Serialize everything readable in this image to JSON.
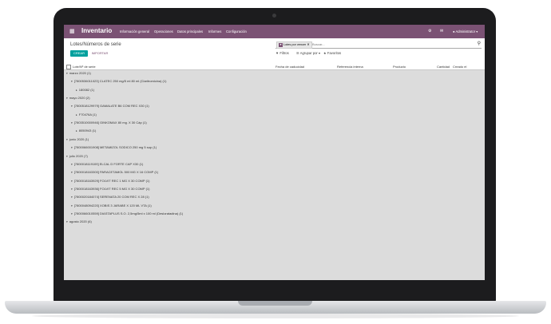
{
  "app": {
    "name": "Inventario"
  },
  "menu": [
    "Información general",
    "Operaciones",
    "Datos principales",
    "Informes",
    "Configuración"
  ],
  "user": {
    "name": "Administrator"
  },
  "control_panel": {
    "breadcrumb": "Lotes/Números de serie",
    "create": "CREAR",
    "import": "IMPORTAR",
    "facet": "Lotes por vencer",
    "search_placeholder": "Buscar...",
    "filters": "Filtros",
    "group_by": "Agrupar por",
    "favorites": "Favoritos"
  },
  "table": {
    "columns": [
      "Lote/Nº de serie",
      "Fecha de caducidad",
      "Referencia interna",
      "Producto",
      "Cantidad",
      "Creado el"
    ]
  },
  "groups": [
    {
      "label": "marzo 2020 (1)",
      "level": 0
    },
    {
      "label": "[7800536011023] CLATEC 250 mg/5 ml 80 ml (Claritromicina) (1)",
      "level": 1
    },
    {
      "label": "180082 (1)",
      "level": 2
    },
    {
      "label": "mayo 2020 (2)",
      "level": 0
    },
    {
      "label": "[7800518129979] GAMALATE B6 COM REC X30 (1)",
      "level": 1
    },
    {
      "label": "F70476A (1)",
      "level": 2
    },
    {
      "label": "[7803510000946] GINKOMAX 80 mg. X 30 Cáp (1)",
      "level": 1
    },
    {
      "label": "8050943 (1)",
      "level": 2
    },
    {
      "label": "junio 2020 (1)",
      "level": 0
    },
    {
      "label": "[7800066001908] METAMIZOL SODICO 250 mg 5 sup (1)",
      "level": 1
    },
    {
      "label": "julio 2020 (7)",
      "level": 0
    },
    {
      "label": "[7800018119109] ELCAL D FORTE CAP X30 (1)",
      "level": 1
    },
    {
      "label": "[7800018163300] PARACETAMOL 500 MG X 16 COMP (1)",
      "level": 1
    },
    {
      "label": "[7800018163929] FOLVIT REC 1 MG X 30 COMP (1)",
      "level": 1
    },
    {
      "label": "[7800018163936] FOLVIT REC 5 MG X 30 COMP (1)",
      "level": 1
    },
    {
      "label": "[7800020184074] SERENATA 20 COM REC X 28 (1)",
      "level": 1
    },
    {
      "label": "[7800048094220] XOBIS 3 JARABE X 120 ML VTA (1)",
      "level": 1
    },
    {
      "label": "[7800066010559] DIASTAPLUS S.O. 2,5mg/5ml x 100 ml (Desloratadina) (1)",
      "level": 1
    },
    {
      "label": "agosto 2020 (6)",
      "level": 0
    }
  ]
}
